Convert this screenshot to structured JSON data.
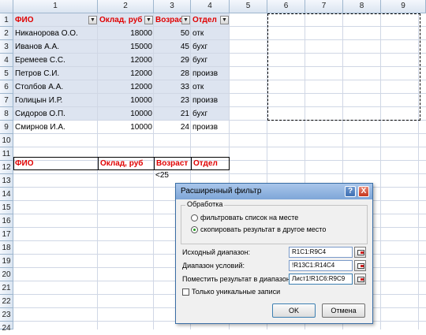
{
  "columns": [
    "1",
    "2",
    "3",
    "4",
    "5",
    "6",
    "7",
    "8",
    "9"
  ],
  "rows": [
    "1",
    "2",
    "3",
    "4",
    "5",
    "6",
    "7",
    "8",
    "9",
    "10",
    "11",
    "12",
    "13",
    "14",
    "15",
    "16",
    "17",
    "18",
    "19",
    "20",
    "21",
    "22",
    "23",
    "24"
  ],
  "table": {
    "headers": [
      "ФИО",
      "Оклад, руб",
      "Возраст",
      "Отдел"
    ],
    "data": [
      [
        "Никанорова О.О.",
        "18000",
        "50",
        "отк"
      ],
      [
        "Иванов А.А.",
        "15000",
        "45",
        "бухг"
      ],
      [
        "Еремеев С.С.",
        "12000",
        "29",
        "бухг"
      ],
      [
        "Петров С.И.",
        "12000",
        "28",
        "произв"
      ],
      [
        "Столбов А.А.",
        "12000",
        "33",
        "отк"
      ],
      [
        "Голицын И.Р.",
        "10000",
        "23",
        "произв"
      ],
      [
        "Сидоров О.П.",
        "10000",
        "21",
        "бухг"
      ],
      [
        "Смирнов И.А.",
        "10000",
        "24",
        "произв"
      ]
    ]
  },
  "criteria": {
    "headers": [
      "ФИО",
      "Оклад, руб",
      "Возраст",
      "Отдел"
    ],
    "condition": "<25"
  },
  "dialog": {
    "title": "Расширенный фильтр",
    "help": "?",
    "close": "X",
    "group_label": "Обработка",
    "radio_filter_in_place": "фильтровать список на месте",
    "radio_copy": "скопировать результат в другое место",
    "source_label": "Исходный диапазон:",
    "source_value": "R1C1:R9C4",
    "criteria_label": "Диапазон условий:",
    "criteria_value": "!R13C1:R14C4",
    "dest_label": "Поместить результат в диапазон:",
    "dest_value": "Лист1!R1C6:R9C9",
    "unique_label": "Только уникальные записи",
    "ok_label": "OK",
    "cancel_label": "Отмена"
  }
}
